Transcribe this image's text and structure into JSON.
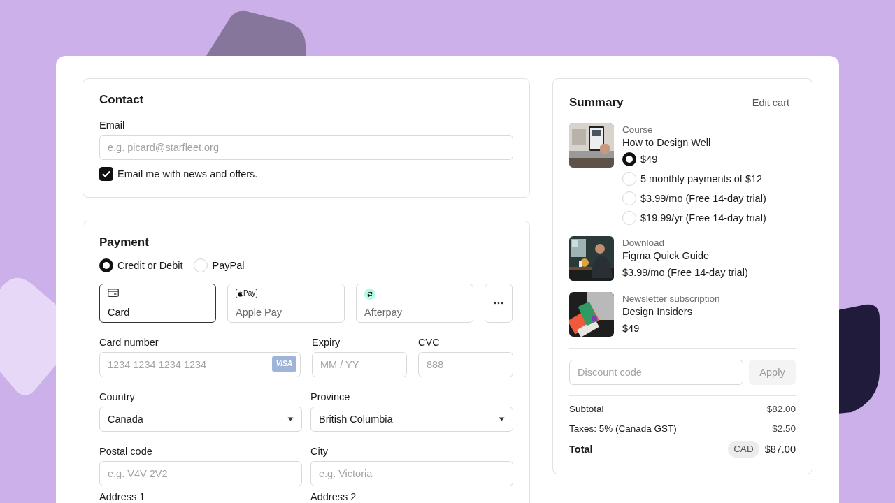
{
  "contact": {
    "title": "Contact",
    "email_label": "Email",
    "email_placeholder": "e.g. picard@starfleet.org",
    "newsletter": {
      "label": "Email me with news and offers.",
      "checked": true
    }
  },
  "payment": {
    "title": "Payment",
    "methods": [
      {
        "label": "Credit or Debit",
        "selected": true
      },
      {
        "label": "PayPal",
        "selected": false
      }
    ],
    "options": [
      {
        "kind": "card",
        "label": "Card",
        "selected": true
      },
      {
        "kind": "applepay",
        "label": "Apple Pay",
        "badge": "Pay",
        "selected": false
      },
      {
        "kind": "afterpay",
        "label": "Afterpay",
        "selected": false
      }
    ],
    "card_number": {
      "label": "Card number",
      "placeholder": "1234 1234 1234 1234",
      "brand": "VISA"
    },
    "expiry": {
      "label": "Expiry",
      "placeholder": "MM / YY"
    },
    "cvc": {
      "label": "CVC",
      "placeholder": "888"
    },
    "country": {
      "label": "Country",
      "value": "Canada"
    },
    "province": {
      "label": "Province",
      "value": "British Columbia"
    },
    "postal_code": {
      "label": "Postal code",
      "placeholder": "e.g. V4V 2V2"
    },
    "city": {
      "label": "City",
      "placeholder": "e.g. Victoria"
    },
    "address_1": {
      "label": "Address 1"
    },
    "address_2": {
      "label": "Address 2"
    }
  },
  "summary": {
    "title": "Summary",
    "edit_cart": "Edit cart",
    "items": [
      {
        "kind": "options",
        "category": "Course",
        "name": "How to Design Well",
        "options": [
          {
            "label": "$49",
            "selected": true
          },
          {
            "label": "5 monthly payments of $12",
            "selected": false
          },
          {
            "label": "$3.99/mo (Free 14-day trial)",
            "selected": false
          },
          {
            "label": "$19.99/yr (Free 14-day trial)",
            "selected": false
          }
        ]
      },
      {
        "kind": "price",
        "category": "Download",
        "name": "Figma Quick Guide",
        "price": "$3.99/mo (Free 14-day trial)"
      },
      {
        "kind": "price",
        "category": "Newsletter subscription",
        "name": "Design Insiders",
        "price": "$49"
      }
    ],
    "discount": {
      "placeholder": "Discount code",
      "button": "Apply",
      "disabled": true
    },
    "lines": [
      {
        "kind": "line",
        "label": "Subtotal",
        "value": "$82.00"
      },
      {
        "kind": "line",
        "label": "Taxes: 5% (Canada GST)",
        "value": "$2.50"
      },
      {
        "kind": "total",
        "label": "Total",
        "currency": "CAD",
        "value": "$87.00"
      }
    ]
  }
}
